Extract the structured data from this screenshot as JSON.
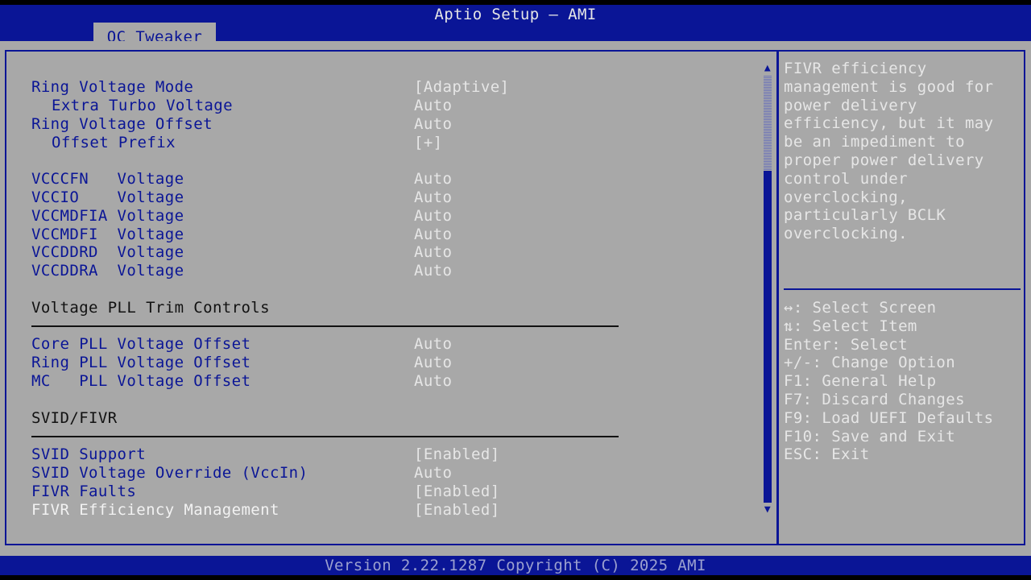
{
  "header": {
    "title": "Aptio Setup – AMI",
    "active_tab": "OC Tweaker"
  },
  "settings": {
    "ring_voltage_mode": {
      "label": "Ring Voltage Mode",
      "value": "[Adaptive]"
    },
    "extra_turbo_voltage": {
      "label": "Extra Turbo Voltage",
      "value": "Auto"
    },
    "ring_voltage_offset": {
      "label": "Ring Voltage Offset",
      "value": "Auto"
    },
    "offset_prefix": {
      "label": "Offset Prefix",
      "value": "[+]"
    },
    "vcccfn_voltage": {
      "label": "VCCCFN   Voltage",
      "value": "Auto"
    },
    "vccio_voltage": {
      "label": "VCCIO    Voltage",
      "value": "Auto"
    },
    "vccmdfia_voltage": {
      "label": "VCCMDFIA Voltage",
      "value": "Auto"
    },
    "vccmdfi_voltage": {
      "label": "VCCMDFI  Voltage",
      "value": "Auto"
    },
    "vccddrd_voltage": {
      "label": "VCCDDRD  Voltage",
      "value": "Auto"
    },
    "vccddra_voltage": {
      "label": "VCCDDRA  Voltage",
      "value": "Auto"
    },
    "pll_heading": "Voltage PLL Trim Controls",
    "core_pll_voltage_offset": {
      "label": "Core PLL Voltage Offset",
      "value": "Auto"
    },
    "ring_pll_voltage_offset": {
      "label": "Ring PLL Voltage Offset",
      "value": "Auto"
    },
    "mc_pll_voltage_offset": {
      "label": "MC   PLL Voltage Offset",
      "value": "Auto"
    },
    "svid_heading": "SVID/FIVR",
    "svid_support": {
      "label": "SVID Support",
      "value": "[Enabled]"
    },
    "svid_voltage_override": {
      "label": "SVID Voltage Override (VccIn)",
      "value": "Auto"
    },
    "fivr_faults": {
      "label": "FIVR Faults",
      "value": "[Enabled]"
    },
    "fivr_efficiency_management": {
      "label": "FIVR Efficiency Management",
      "value": "[Enabled]"
    }
  },
  "help": {
    "text": "FIVR efficiency management is good for power delivery efficiency, but it may be an impediment to proper power delivery control under overclocking, particularly BCLK overclocking."
  },
  "keys": [
    "↔: Select Screen",
    "⇅: Select Item",
    "Enter: Select",
    "+/-: Change Option",
    "F1: General Help",
    "F7: Discard Changes",
    "F9: Load UEFI Defaults",
    "F10: Save and Exit",
    "ESC: Exit"
  ],
  "footer": {
    "version": "Version 2.22.1287 Copyright (C) 2025 AMI"
  },
  "colors": {
    "bios_blue": "#0a1596",
    "panel_gray": "#a8a8a8",
    "value_white": "#e6e6e6"
  }
}
